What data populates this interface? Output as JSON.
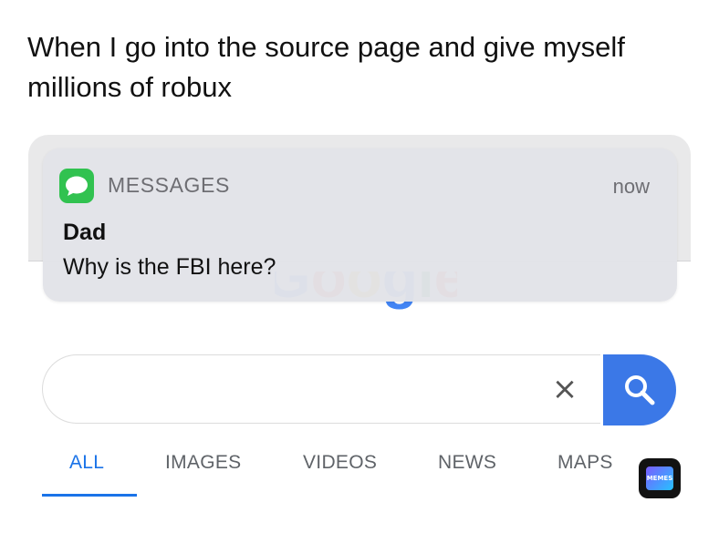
{
  "caption": "When I go into the source page and give myself millions of robux",
  "google": {
    "logo_text": "Google",
    "clear_label": "×",
    "tabs": [
      {
        "label": "ALL",
        "active": true
      },
      {
        "label": "IMAGES",
        "active": false
      },
      {
        "label": "VIDEOS",
        "active": false
      },
      {
        "label": "NEWS",
        "active": false
      },
      {
        "label": "MAPS",
        "active": false
      }
    ]
  },
  "notification": {
    "app_name": "MESSAGES",
    "time": "now",
    "sender": "Dad",
    "message": "Why is the FBI here?",
    "icon": "messages-bubble-icon"
  },
  "watermark": {
    "text": "MEMES"
  },
  "colors": {
    "google_blue": "#3b78e7",
    "tab_active": "#1a73e8",
    "messages_green": "#31c250",
    "google_red": "#ea4335",
    "google_yellow": "#fbbc05",
    "google_green": "#34a853"
  }
}
